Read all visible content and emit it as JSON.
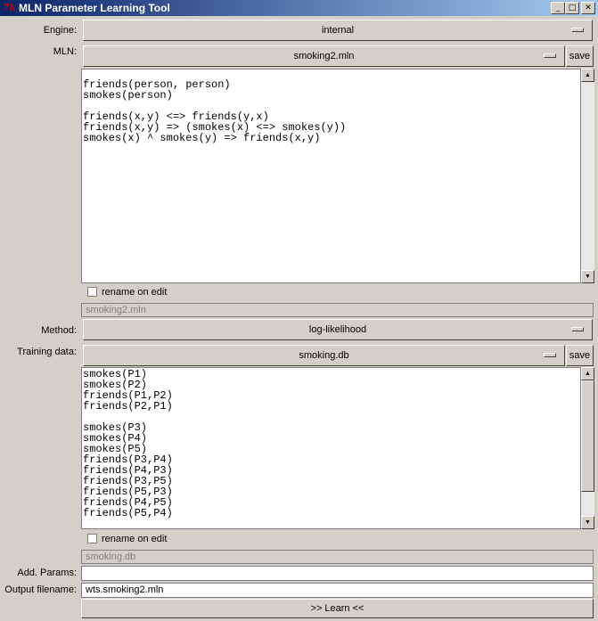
{
  "window": {
    "title": "MLN Parameter Learning Tool",
    "icon_glyph": "7k",
    "controls": {
      "minimize": "_",
      "maximize": "□",
      "close": "✕"
    }
  },
  "engine": {
    "label": "Engine:",
    "value": "internal"
  },
  "mln": {
    "label": "MLN:",
    "file": "smoking2.mln",
    "save_label": "save",
    "content": "friends(person, person)\nsmokes(person)\n\nfriends(x,y) <=> friends(y,x)\nfriends(x,y) => (smokes(x) <=> smokes(y))\nsmokes(x) ^ smokes(y) => friends(x,y)",
    "rename_label": "rename on edit",
    "filename": "smoking2.mln"
  },
  "method": {
    "label": "Method:",
    "value": "log-likelihood"
  },
  "training": {
    "label": "Training data:",
    "file": "smoking.db",
    "save_label": "save",
    "content": "smokes(P1)\nsmokes(P2)\nfriends(P1,P2)\nfriends(P2,P1)\n\nsmokes(P3)\nsmokes(P4)\nsmokes(P5)\nfriends(P3,P4)\nfriends(P4,P3)\nfriends(P3,P5)\nfriends(P5,P3)\nfriends(P4,P5)\nfriends(P5,P4)",
    "rename_label": "rename on edit",
    "filename": "smoking.db"
  },
  "params": {
    "label": "Add. Params:",
    "value": ""
  },
  "output": {
    "label": "Output filename:",
    "value": "wts.smoking2.mln"
  },
  "learn_label": ">> Learn <<",
  "icons": {
    "scroll_up": "▲",
    "scroll_down": "▼"
  }
}
